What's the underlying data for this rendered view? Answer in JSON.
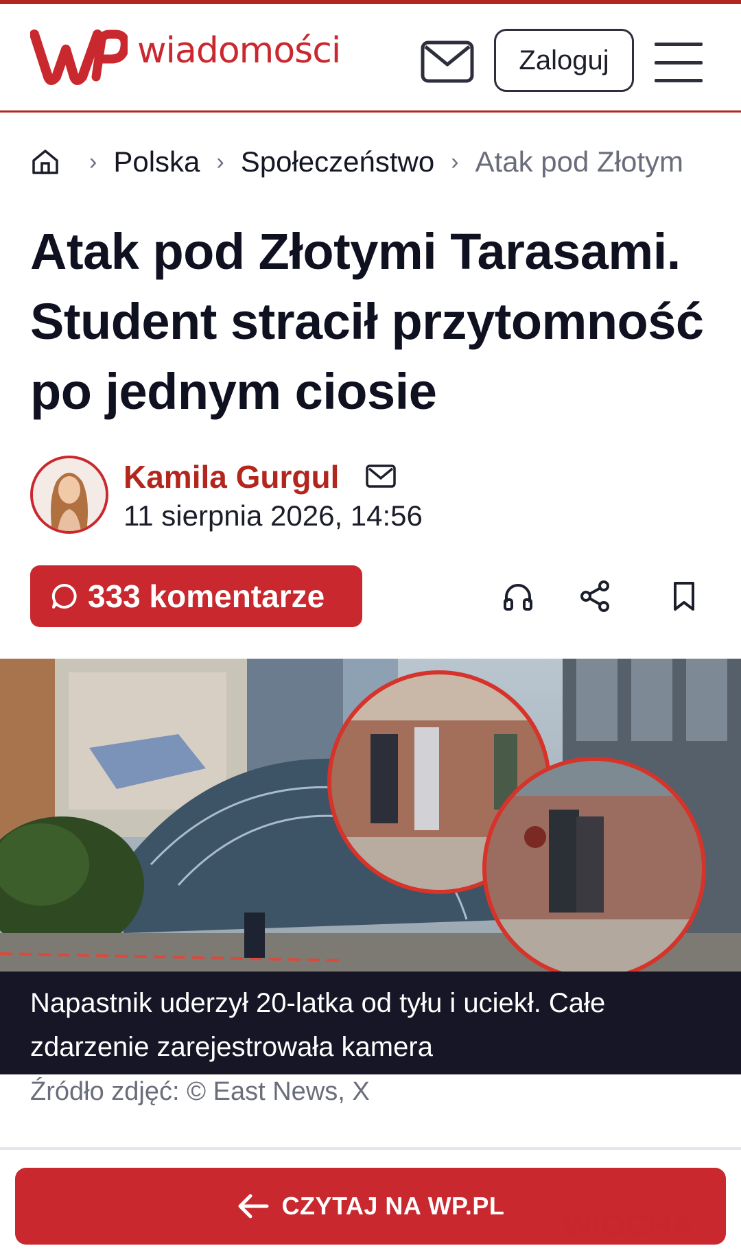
{
  "header": {
    "logo_text": "wiadomości",
    "login_label": "Zaloguj"
  },
  "breadcrumb": {
    "items": [
      "Polska",
      "Społeczeństwo"
    ],
    "current": "Atak pod Złotym"
  },
  "article": {
    "title_lines": [
      "Atak pod Złotymi Tarasami.",
      "Student stracił przytomność",
      "po jednym ciosie"
    ],
    "author": "Kamila Gurgul",
    "date": "11 sierpnia 2026, 14:56",
    "comments_label": "333 komentarze",
    "caption_lines": [
      "Napastnik uderzył 20-latka od tyłu i uciekł. Całe",
      "zdarzenie zarejestrowała kamera"
    ],
    "source": "Źródło zdjęć: © East News, X"
  },
  "cta": {
    "label": "CZYTAJ NA WP.PL"
  },
  "watermark": {
    "text": "WIOCHA"
  },
  "icons": {
    "home": "home-icon",
    "mail": "mail-icon",
    "menu": "menu-icon",
    "comment": "comment-icon",
    "headphones": "headphones-icon",
    "share": "share-icon",
    "bookmark": "bookmark-icon",
    "arrow": "arrow-left-icon"
  },
  "colors": {
    "accent": "#c8282e",
    "dark": "#161626",
    "text": "#111322",
    "muted": "#6a6d7a"
  }
}
